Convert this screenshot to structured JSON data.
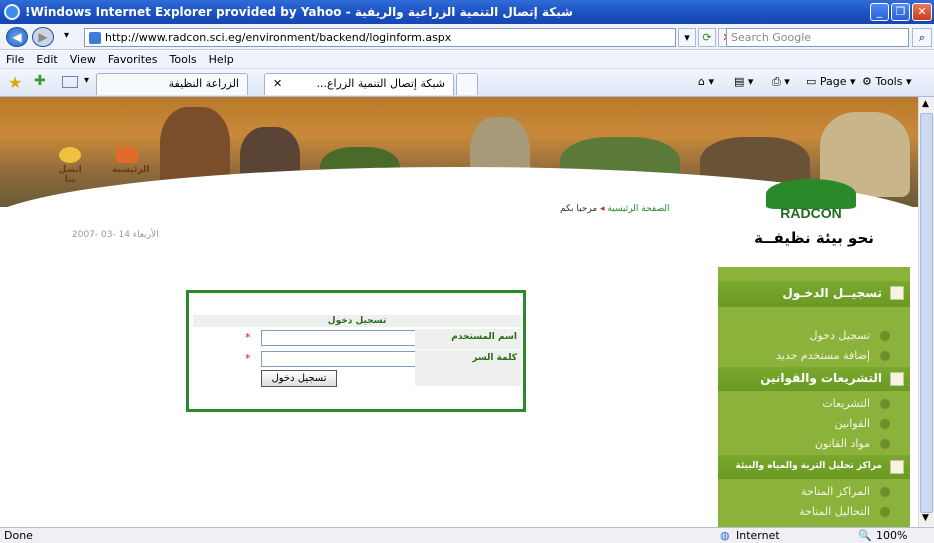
{
  "window": {
    "title": "شبكة إتصال التنمية الزراعية والريفية - Windows Internet Explorer provided by Yahoo!"
  },
  "address": {
    "url": "http://www.radcon.sci.eg/environment/backend/loginform.aspx",
    "search_placeholder": "Search Google"
  },
  "menu": [
    "File",
    "Edit",
    "View",
    "Favorites",
    "Tools",
    "Help"
  ],
  "tabs": [
    {
      "label": "الزراعة النظيفة"
    },
    {
      "label": "شبكة إتصال التنمية الزراع..."
    }
  ],
  "toolbar": {
    "page_label": "Page",
    "tools_label": "Tools"
  },
  "site": {
    "nav": [
      {
        "label": "الرئيسية"
      },
      {
        "label": "اتصل بنا"
      }
    ],
    "date": "الأربعاء 14 -03 -2007",
    "breadcrumb": {
      "home": "الصفحة الرئيسية",
      "current": "مرحبا بكم"
    },
    "logo_text": "RADCON",
    "slogan": "نحو بيئة نظيفــة"
  },
  "login": {
    "header": "تسجيل دخول",
    "username_label": "اسم المستخدم",
    "password_label": "كلمة السر",
    "submit_label": "تسجيل دخول",
    "required_mark": "*"
  },
  "sidemenu": {
    "sections": [
      {
        "title": "تسجيــل الدخـول",
        "items": [
          "تسجيل دخول",
          "إضافة مستخدم جديد"
        ]
      },
      {
        "title": "التشريعات والقوانين",
        "items": [
          "التشريعات",
          "القوانين",
          "مواد القانون"
        ]
      },
      {
        "title": "مراكز تحليل التربة والمياه والبيئة",
        "items": [
          "المراكز المتاحة",
          "التحاليل المتاحة"
        ]
      }
    ]
  },
  "status": {
    "left": "Done",
    "zone": "Internet",
    "zoom": "100%"
  },
  "colors": {
    "frame_green": "#2a8a2a",
    "menu_green": "#8bb23a",
    "title_blue": "#1a4fbf"
  }
}
